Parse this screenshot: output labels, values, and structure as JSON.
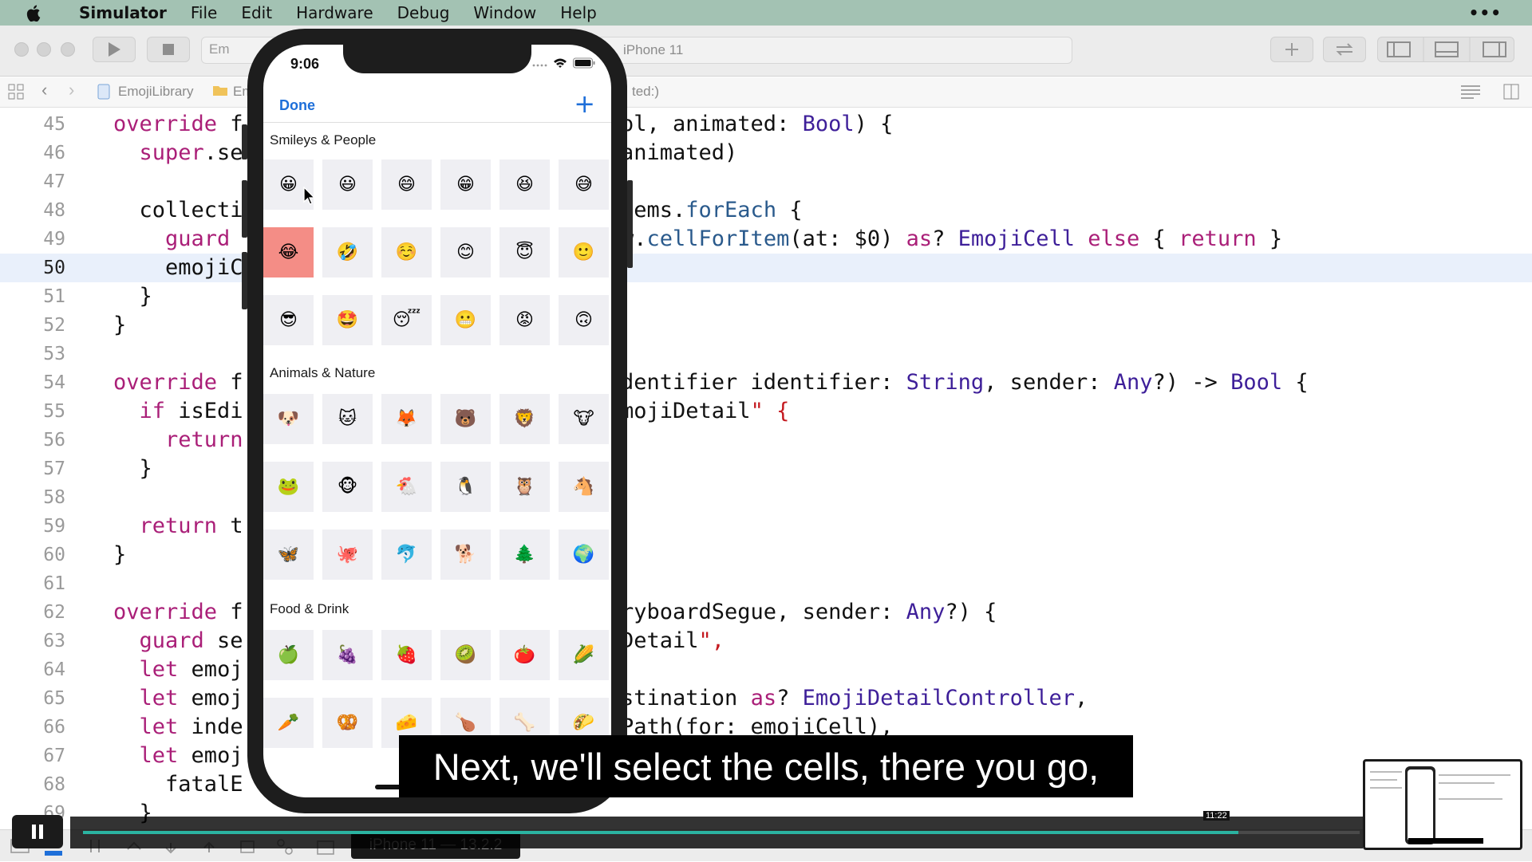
{
  "menubar": {
    "app": "Simulator",
    "items": [
      "File",
      "Edit",
      "Hardware",
      "Debug",
      "Window",
      "Help"
    ]
  },
  "toolbar": {
    "scheme_left": "Em",
    "destination": "iPhone 11"
  },
  "jumpbar": {
    "project": "EmojiLibrary",
    "folder": "Em",
    "method_fragment": "ted:)"
  },
  "editor": {
    "active_line": 50,
    "lines": [
      {
        "n": "45",
        "left": "override f",
        "right": "ol, animated: Bool) {"
      },
      {
        "n": "46",
        "left": "  super.se",
        "right": "animated)"
      },
      {
        "n": "47",
        "left": "",
        "right": ""
      },
      {
        "n": "48",
        "left": "  collecti",
        "right": "tems.forEach {"
      },
      {
        "n": "49",
        "left": "    guard",
        "right": "w.cellForItem(at: $0) as? EmojiCell else { return }"
      },
      {
        "n": "50",
        "left": "    emojiC",
        "right": ""
      },
      {
        "n": "51",
        "left": "  }",
        "right": ""
      },
      {
        "n": "52",
        "left": "}",
        "right": ""
      },
      {
        "n": "53",
        "left": "",
        "right": ""
      },
      {
        "n": "54",
        "left": "override f",
        "right": "dentifier identifier: String, sender: Any?) -> Bool {"
      },
      {
        "n": "55",
        "left": "  if isEdi",
        "right": "mojiDetail\" {"
      },
      {
        "n": "56",
        "left": "    return",
        "right": ""
      },
      {
        "n": "57",
        "left": "  }",
        "right": ""
      },
      {
        "n": "58",
        "left": "",
        "right": ""
      },
      {
        "n": "59",
        "left": "  return t",
        "right": ""
      },
      {
        "n": "60",
        "left": "}",
        "right": ""
      },
      {
        "n": "61",
        "left": "",
        "right": ""
      },
      {
        "n": "62",
        "left": "override f",
        "right": "ryboardSegue, sender: Any?) {"
      },
      {
        "n": "63",
        "left": "  guard se",
        "right": "Detail\","
      },
      {
        "n": "64",
        "left": "  let emoj",
        "right": ""
      },
      {
        "n": "65",
        "left": "  let emoj",
        "right": "stination as? EmojiDetailController,"
      },
      {
        "n": "66",
        "left": "  let inde",
        "right": "Path(for: emojiCell),"
      },
      {
        "n": "67",
        "left": "  let emoj",
        "right": ""
      },
      {
        "n": "68",
        "left": "    fatalE",
        "right": ""
      },
      {
        "n": "69",
        "left": "  }",
        "right": ""
      }
    ]
  },
  "simulator": {
    "time": "9:06",
    "nav": {
      "done": "Done",
      "add": "+"
    },
    "selected": {
      "section": 0,
      "index": 6
    },
    "sections": [
      {
        "title": "Smileys & People",
        "emojis": [
          "😀",
          "😃",
          "😄",
          "😁",
          "😆",
          "😅",
          "😂",
          "🤣",
          "☺️",
          "😊",
          "😇",
          "🙂",
          "😎",
          "🤩",
          "😴",
          "😬",
          "😡",
          "🙃"
        ],
        "rows": 3
      },
      {
        "title": "Animals & Nature",
        "emojis": [
          "🐶",
          "🐱",
          "🦊",
          "🐻",
          "🦁",
          "🐮",
          "🐸",
          "🐵",
          "🐔",
          "🐧",
          "🦉",
          "🐴",
          "🦋",
          "🐙",
          "🐬",
          "🐕",
          "🌲",
          "🌍"
        ],
        "rows": 3
      },
      {
        "title": "Food & Drink",
        "emojis": [
          "🍏",
          "🍇",
          "🍓",
          "🥝",
          "🍅",
          "🌽",
          "🥕",
          "🥨",
          "🧀",
          "🍗",
          "🦴",
          "🌮"
        ],
        "rows": 2
      }
    ]
  },
  "caption": "Next, we'll select the cells, there you go,",
  "debug": {
    "target": "iPhone 11 — 13.2.2"
  },
  "player": {
    "timestamp": "11:22",
    "progress": 0.905
  },
  "colors": {
    "accent": "#1e6fd9",
    "selected_cell": "#f48d86",
    "progress": "#2bb3a1"
  }
}
